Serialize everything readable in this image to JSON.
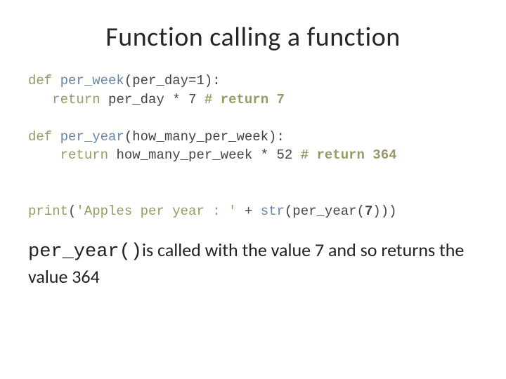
{
  "title": "Function calling a function",
  "code": {
    "l1": {
      "def": "def ",
      "name": "per_week",
      "sig": "(per_day=1):"
    },
    "l2": {
      "indent": "   ",
      "ret": "return ",
      "expr": "per_day * 7 ",
      "cmt": "# return 7"
    },
    "l3": "",
    "l4": {
      "def": "def ",
      "name": "per_year",
      "sig": "(how_many_per_week):"
    },
    "l5": {
      "indent": "    ",
      "ret": "return ",
      "expr": "how_many_per_week * 52 ",
      "cmt": "# return 364"
    },
    "l6": "",
    "l7": {
      "print": "print",
      "open": "(",
      "str": "'Apples per year : '",
      "plus": " + ",
      "strfn": "str",
      "open2": "(per_year(",
      "seven": "7",
      "close": ")))"
    }
  },
  "explain": {
    "fn": "per_year()",
    "rest": "is called with the value 7 and so returns the value 364"
  }
}
